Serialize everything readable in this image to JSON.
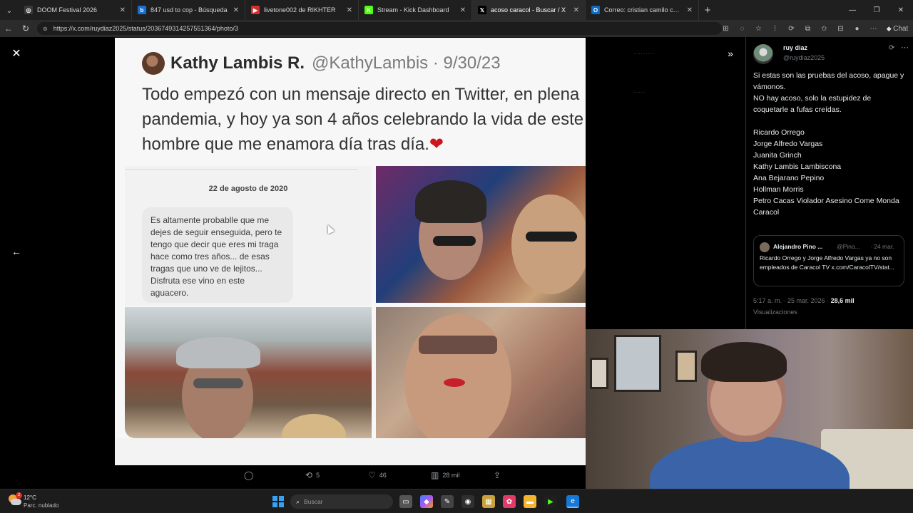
{
  "browser": {
    "tabs": [
      {
        "title": "DOOM Festival 2026",
        "favicon": "globe-icon",
        "fav_bg": "#3a3a3a",
        "fav_glyph": "◎"
      },
      {
        "title": "847 usd to cop - Búsqueda",
        "favicon": "bing-icon",
        "fav_bg": "#1b6fd1",
        "fav_glyph": "b"
      },
      {
        "title": "livetone002 de RIKHTER",
        "favicon": "youtube-icon",
        "fav_bg": "#d32f2f",
        "fav_glyph": "▶"
      },
      {
        "title": "Stream - Kick Dashboard",
        "favicon": "kick-icon",
        "fav_bg": "#53fc18",
        "fav_glyph": "K"
      },
      {
        "title": "acoso caracol - Buscar / X",
        "favicon": "x-icon",
        "fav_bg": "#000000",
        "fav_glyph": "𝕏"
      },
      {
        "title": "Correo: cristian camilo castro soto",
        "favicon": "outlook-icon",
        "fav_bg": "#0f6cbd",
        "fav_glyph": "O"
      }
    ],
    "url": "https://x.com/ruydiaz2025/status/2036749314257551364/photo/3",
    "chat_label": "Chat"
  },
  "image": {
    "author_name": "Kathy Lambis R.",
    "author_handle": "@KathyLambis",
    "date": "9/30/23",
    "quote": "Todo empezó con un mensaje directo en Twitter, en plena pandemia, y hoy ya son 4 años celebrando la vida de este hombre que me enamora día tras día.",
    "heart": "❤",
    "dm_date": "22 de agosto de 2020",
    "dm_message": "Es altamente probablle que me dejes de seguir enseguida, pero te tengo que decir que eres mi traga hace como tres años... de esas tragas que uno ve de lejitos... Disfruta ese vino en este aguacero."
  },
  "actions": {
    "reply_count": "",
    "retweet_count": "5",
    "like_count": "46",
    "views_count": "28 mil"
  },
  "tweet": {
    "name": "ruy diaz",
    "handle": "@ruydiaz2025",
    "body_lines": [
      "Si estas son las pruebas del acoso, apague y vámonos.",
      "NO hay acoso, solo la estupidez de coquetarle a fufas creídas.",
      "",
      "Ricardo Orrego",
      "Jorge Alfredo Vargas",
      "Juanita Grinch",
      "Kathy Lambis Lambiscona",
      "Ana  Bejarano Pepino",
      "Hollman Morris",
      "Petro Cacas Violador Asesino Come Monda",
      "Caracol"
    ],
    "quoted": {
      "name": "Alejandro Pino ...",
      "handle": "@Pino...",
      "time": "· 24 mar.",
      "text": "Ricardo Orrego y Jorge Alfredo Vargas ya no son empleados de Caracol TV x.com/CaracolTV/stat..."
    },
    "timestamp": "5:17 a. m. · 25 mar. 2026 · ",
    "views": "28,6 mil",
    "views_label": "Visualizaciones"
  },
  "taskbar": {
    "temp": "12°C",
    "weather": "Parc. nublado",
    "weather_badge": "2",
    "search_placeholder": "Buscar"
  }
}
